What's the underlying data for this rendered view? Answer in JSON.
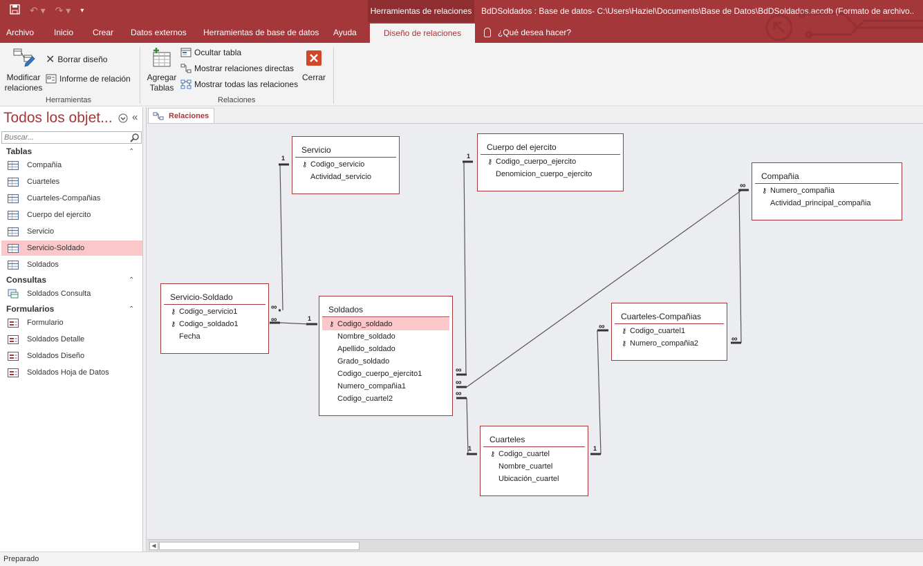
{
  "window": {
    "context_tab_title": "Herramientas de relaciones",
    "app_title": "BdDSoldados : Base de datos- C:\\Users\\Haziel\\Documents\\Base de Datos\\BdDSoldados.accdb (Formato de archivo..."
  },
  "ribbon_tabs": [
    "Archivo",
    "Inicio",
    "Crear",
    "Datos externos",
    "Herramientas de base de datos",
    "Ayuda",
    "Diseño de relaciones"
  ],
  "tell_me": "¿Qué desea hacer?",
  "ribbon": {
    "modify_line1": "Modificar",
    "modify_line2": "relaciones",
    "clear_layout": "Borrar diseño",
    "relationship_report": "Informe de relación",
    "group_tools": "Herramientas",
    "add_line1": "Agregar",
    "add_line2": "Tablas",
    "hide_table": "Ocultar tabla",
    "direct_relationships": "Mostrar relaciones directas",
    "all_relationships": "Mostrar todas las relaciones",
    "close": "Cerrar",
    "group_relationships": "Relaciones"
  },
  "nav": {
    "title": "Todos los objet...",
    "search_placeholder": "Buscar...",
    "sections": {
      "tables": "Tablas",
      "queries": "Consultas",
      "forms": "Formularios"
    },
    "tables": [
      "Compañia",
      "Cuarteles",
      "Cuarteles-Compañias",
      "Cuerpo del ejercito",
      "Servicio",
      "Servicio-Soldado",
      "Soldados"
    ],
    "queries": [
      "Soldados Consulta"
    ],
    "forms": [
      "Formulario",
      "Soldados Detalle",
      "Soldados Diseño",
      "Soldados Hoja de Datos"
    ]
  },
  "doc_tab": "Relaciones",
  "diagram": {
    "tables": {
      "servicio": {
        "title": "Servicio",
        "fields": [
          "Codigo_servicio",
          "Actividad_servicio"
        ]
      },
      "cuerpo": {
        "title": "Cuerpo del ejercito",
        "fields": [
          "Codigo_cuerpo_ejercito",
          "Denomicion_cuerpo_ejercito"
        ]
      },
      "compania": {
        "title": "Compañia",
        "fields": [
          "Numero_compañia",
          "Actividad_principal_compañia"
        ]
      },
      "servsold": {
        "title": "Servicio-Soldado",
        "fields": [
          "Codigo_servicio1",
          "Codigo_soldado1",
          "Fecha"
        ]
      },
      "soldados": {
        "title": "Soldados",
        "fields": [
          "Codigo_soldado",
          "Nombre_soldado",
          "Apellido_soldado",
          "Grado_soldado",
          "Codigo_cuerpo_ejercito1",
          "Numero_compañia1",
          "Codigo_cuartel2"
        ]
      },
      "cuartcomp": {
        "title": "Cuarteles-Compañias",
        "fields": [
          "Codigo_cuartel1",
          "Numero_compañia2"
        ]
      },
      "cuarteles": {
        "title": "Cuarteles",
        "fields": [
          "Codigo_cuartel",
          "Nombre_cuartel",
          "Ubicación_cuartel"
        ]
      }
    },
    "cardinality_one": "1",
    "cardinality_many": "∞"
  },
  "status": "Preparado",
  "colors": {
    "accent": "#a4373a",
    "selection": "#fbc7c9",
    "canvas": "#ecedf0"
  }
}
